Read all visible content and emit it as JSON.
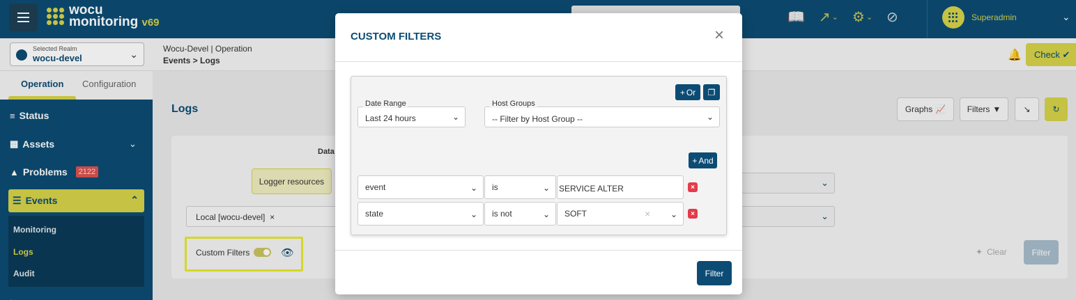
{
  "header": {
    "logo_line1": "wocu",
    "logo_line2": "monitoring",
    "logo_version": "v69",
    "user_name": "Superadmin"
  },
  "realm": {
    "caption": "Selected Realm",
    "value": "wocu-devel"
  },
  "breadcrumb": {
    "line1": "Wocu-Devel | Operation",
    "line2": "Events > Logs"
  },
  "check_label": "Check",
  "sidebar": {
    "tabs": [
      "Operation",
      "Configuration"
    ],
    "items": [
      {
        "label": "Status"
      },
      {
        "label": "Assets"
      },
      {
        "label": "Problems",
        "badge": "2122"
      },
      {
        "label": "Events"
      }
    ],
    "sub_items": [
      "Monitoring",
      "Logs",
      "Audit"
    ]
  },
  "content": {
    "title": "Logs",
    "graphs_label": "Graphs",
    "filters_label": "Filters",
    "data_label": "Data",
    "logger_resources": "Logger resources",
    "realm_chip": "Local [wocu-devel]",
    "custom_filters_label": "Custom Filters",
    "clear_label": "Clear",
    "filter_label": "Filter"
  },
  "modal": {
    "title": "CUSTOM FILTERS",
    "or_label": "Or",
    "and_label": "And",
    "date_range": {
      "label": "Date Range",
      "value": "Last 24 hours"
    },
    "host_groups": {
      "label": "Host Groups",
      "value": "-- Filter by Host Group --"
    },
    "rules": [
      {
        "field": "event",
        "operator": "is",
        "value": "SERVICE ALTER"
      },
      {
        "field": "state",
        "operator": "is not",
        "value": "SOFT"
      }
    ],
    "filter_button": "Filter"
  },
  "colors": {
    "primary": "#0c4c74",
    "accent": "#d6d34a",
    "danger": "#e33b4b",
    "highlight": "#e8ea2c"
  }
}
